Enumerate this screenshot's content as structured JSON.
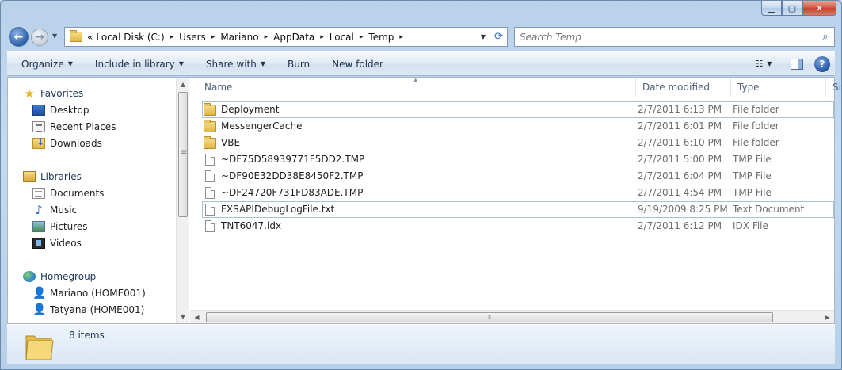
{
  "window": {
    "minimize": "▁",
    "maximize": "▢",
    "close": "✕"
  },
  "address": {
    "overflow": "«",
    "crumbs": [
      "Local Disk (C:)",
      "Users",
      "Mariano",
      "AppData",
      "Local",
      "Temp"
    ],
    "separator": "▸"
  },
  "search": {
    "placeholder": "Search Temp"
  },
  "toolbar": {
    "organize": "Organize",
    "include_in_library": "Include in library",
    "share_with": "Share with",
    "burn": "Burn",
    "new_folder": "New folder",
    "help": "?"
  },
  "nav": {
    "favorites": {
      "label": "Favorites",
      "items": [
        "Desktop",
        "Recent Places",
        "Downloads"
      ]
    },
    "libraries": {
      "label": "Libraries",
      "items": [
        "Documents",
        "Music",
        "Pictures",
        "Videos"
      ]
    },
    "homegroup": {
      "label": "Homegroup",
      "items": [
        "Mariano (HOME001)",
        "Tatyana (HOME001)"
      ]
    }
  },
  "columns": {
    "name": "Name",
    "date_modified": "Date modified",
    "type": "Type",
    "size": "Siz"
  },
  "files": [
    {
      "name": "Deployment",
      "date": "2/7/2011 6:13 PM",
      "type": "File folder",
      "kind": "folder"
    },
    {
      "name": "MessengerCache",
      "date": "2/7/2011 6:01 PM",
      "type": "File folder",
      "kind": "folder"
    },
    {
      "name": "VBE",
      "date": "2/7/2011 6:10 PM",
      "type": "File folder",
      "kind": "folder"
    },
    {
      "name": "~DF75D58939771F5DD2.TMP",
      "date": "2/7/2011 5:00 PM",
      "type": "TMP File",
      "kind": "file"
    },
    {
      "name": "~DF90E32DD38E8450F2.TMP",
      "date": "2/7/2011 6:04 PM",
      "type": "TMP File",
      "kind": "file"
    },
    {
      "name": "~DF24720F731FD83ADE.TMP",
      "date": "2/7/2011 4:54 PM",
      "type": "TMP File",
      "kind": "file"
    },
    {
      "name": "FXSAPIDebugLogFile.txt",
      "date": "9/19/2009 8:25 PM",
      "type": "Text Document",
      "kind": "file"
    },
    {
      "name": "TNT6047.idx",
      "date": "2/7/2011 6:12 PM",
      "type": "IDX File",
      "kind": "file"
    }
  ],
  "status": {
    "item_count": "8 items"
  }
}
